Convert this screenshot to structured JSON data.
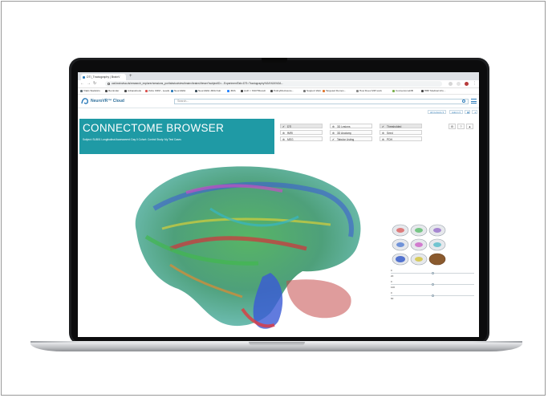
{
  "browser": {
    "tab_title": "DTI_Tractography | BrainV",
    "tab_new": "+",
    "address": "uat.brainvisa.ds/research_explorer/sessions_por/tabstoolview/brainv/brainsViewer?subjectID=...ExperimentTab=DTI=Tractography%2A%2A%2A...",
    "bookmarks": [
      {
        "label": "Vitals Statistics",
        "color": "#5b6b74"
      },
      {
        "label": "Reminder",
        "color": "#4b4b4b"
      },
      {
        "label": "Adnassbook",
        "color": "#4b4b4b"
      },
      {
        "label": "Zoho CRM - Leads",
        "color": "#d9534f"
      },
      {
        "label": "NeuroWiki",
        "color": "#2b7bb9"
      },
      {
        "label": "NeuroWiki JIRA Nuit",
        "color": "#3d4f5c"
      },
      {
        "label": "JIRA",
        "color": "#2684ff"
      },
      {
        "label": "Auth > SSO?Result",
        "color": "#444444"
      },
      {
        "label": "PolicyDisclosure...",
        "color": "#4b4b4b"
      },
      {
        "label": "Support Web",
        "color": "#777777"
      },
      {
        "label": "Targeted Demos...",
        "color": "#e0752d"
      },
      {
        "label": "How Does MIP work",
        "color": "#888888"
      },
      {
        "label": "ConnectomeDB",
        "color": "#7bb04b"
      },
      {
        "label": "HBP Medical Info...",
        "color": "#444444"
      }
    ]
  },
  "app": {
    "logo_text": "NeuroVR™ Cloud",
    "search_placeholder": "Search...",
    "sub_buttons": [
      "All Cohorts ▾",
      "Admin ▾"
    ],
    "banner": {
      "title": "CONNECTOME BROWSER",
      "meta": "Subject: SUB01    Longitudinal Assessment: Day 0    Cohort: Control    Study: My Test Cases"
    },
    "options": [
      {
        "label": "DTI",
        "mark": "✔",
        "selected": true
      },
      {
        "label": "3D Lesions",
        "mark": "⊕",
        "selected": false
      },
      {
        "label": "Thresholded",
        "mark": "✔",
        "selected": true
      },
      {
        "label": "fMRI",
        "mark": "⊕",
        "selected": false
      },
      {
        "label": "3D Anatomy",
        "mark": "⊕",
        "selected": false
      },
      {
        "label": "Seed",
        "mark": "⊕",
        "selected": false
      },
      {
        "label": "MEG",
        "mark": "⊕",
        "selected": false
      },
      {
        "label": "Tabular Listing",
        "mark": "✔",
        "selected": false
      },
      {
        "label": "PDH",
        "mark": "⊕",
        "selected": false
      }
    ],
    "controls": [
      "⚙",
      "?",
      "▲"
    ],
    "sliders": [
      {
        "top_label": "0",
        "bottom_label": "20",
        "value": 0.5
      },
      {
        "top_label": "0",
        "bottom_label": "100",
        "value": 0.5
      },
      {
        "top_label": "0",
        "bottom_label": "60",
        "value": 0.5
      }
    ]
  },
  "colors": {
    "banner": "#1f9aa5",
    "accent": "#2b7bb9"
  }
}
